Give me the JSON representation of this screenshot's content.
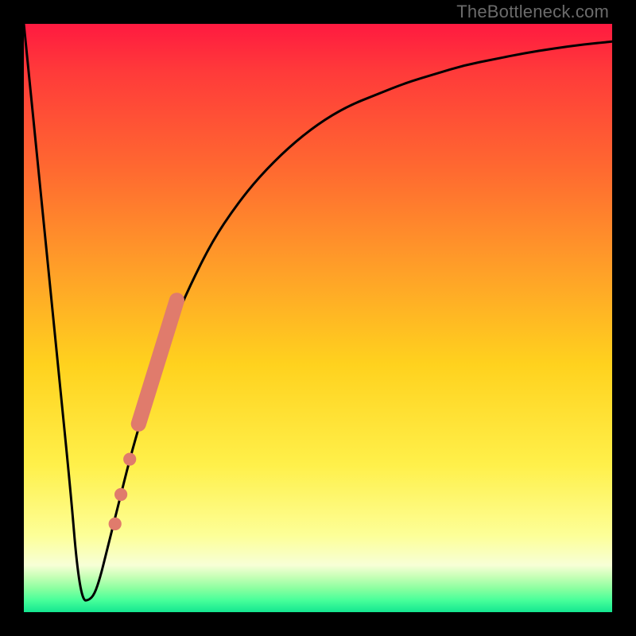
{
  "watermark": "TheBottleneck.com",
  "colors": {
    "background_frame": "#000000",
    "curve_stroke": "#000000",
    "marker_fill": "#e07b6c",
    "gradient_top": "#ff1a40",
    "gradient_mid": "#ffd21e",
    "gradient_bottom": "#14e690",
    "watermark": "#6b6b6b"
  },
  "chart_data": {
    "type": "line",
    "title": "",
    "xlabel": "",
    "ylabel": "",
    "xlim": [
      0,
      100
    ],
    "ylim": [
      0,
      100
    ],
    "grid": false,
    "legend": "none",
    "annotations": [
      "TheBottleneck.com"
    ],
    "series": [
      {
        "name": "bottleneck-curve",
        "x": [
          0,
          2,
          4,
          6,
          8,
          9,
          10,
          11,
          12,
          13,
          14,
          16,
          18,
          20,
          22,
          25,
          28,
          32,
          36,
          40,
          45,
          50,
          55,
          60,
          65,
          70,
          75,
          80,
          85,
          90,
          95,
          100
        ],
        "y": [
          100,
          80,
          60,
          40,
          20,
          8,
          2,
          2,
          3,
          6,
          10,
          18,
          26,
          33,
          40,
          48,
          55,
          63,
          69,
          74,
          79,
          83,
          86,
          88,
          90,
          91.5,
          93,
          94,
          95,
          95.8,
          96.5,
          97
        ]
      }
    ],
    "markers": [
      {
        "shape": "circle",
        "x": 15.5,
        "y": 15,
        "r": 1.1
      },
      {
        "shape": "circle",
        "x": 16.5,
        "y": 20,
        "r": 1.1
      },
      {
        "shape": "circle",
        "x": 18.0,
        "y": 26,
        "r": 1.1
      },
      {
        "shape": "rounded-line",
        "x1": 19.5,
        "y1": 32,
        "x2": 26.0,
        "y2": 53,
        "width": 2.6
      }
    ]
  }
}
